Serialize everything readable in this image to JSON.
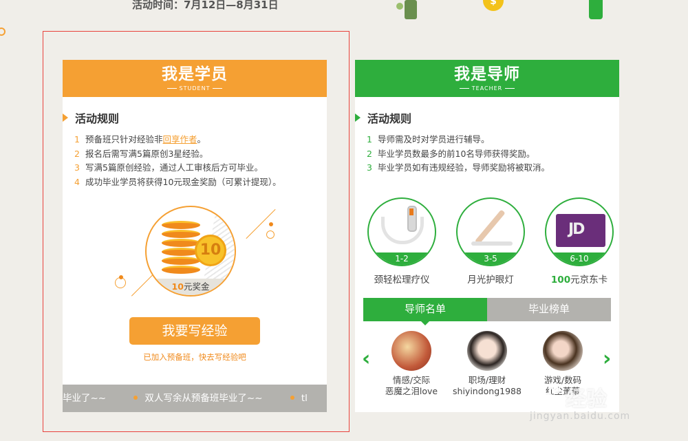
{
  "header": {
    "event_date": "活动时间：7月12日—8月31日"
  },
  "student_card": {
    "title": "我是学员",
    "subtitle": "STUDENT",
    "rules_heading": "活动规则",
    "rules": [
      {
        "num": "1",
        "text": "预备班只针对经验非",
        "link": "回享作者",
        "after": "。"
      },
      {
        "num": "2",
        "text": "报名后需写满5篇原创3星经验。"
      },
      {
        "num": "3",
        "text": "写满5篇原创经验，通过人工审核后方可毕业。"
      },
      {
        "num": "4",
        "text": "成功毕业学员将获得10元现金奖励（可累计提现）。"
      }
    ],
    "coin_value": "10",
    "reward_amount": "10",
    "reward_unit": "元奖金",
    "write_button": "我要写经验",
    "joined_note": "已加入预备班，快去写经验吧",
    "ticker_left": "毕业了~~",
    "ticker_main": "双人写余从预备班毕业了~~",
    "ticker_right": "tl"
  },
  "teacher_card": {
    "title": "我是导师",
    "subtitle": "TEACHER",
    "rules_heading": "活动规则",
    "rules": [
      {
        "num": "1",
        "text": "导师需及时对学员进行辅导。"
      },
      {
        "num": "2",
        "text": "毕业学员数最多的前10名导师获得奖励。"
      },
      {
        "num": "3",
        "text": "毕业学员如有违规经验，导师奖励将被取消。"
      }
    ],
    "prizes": [
      {
        "range": "1-2",
        "name": "颈轻松理疗仪",
        "icon": "massager-image"
      },
      {
        "range": "3-5",
        "name": "月光护眼灯",
        "icon": "lamp-image"
      },
      {
        "range": "6-10",
        "name_bold": "100",
        "name": "元京东卡",
        "icon": "jd-card-image"
      }
    ],
    "tabs": [
      {
        "label": "导师名单",
        "active": true
      },
      {
        "label": "毕业榜单",
        "active": false
      }
    ],
    "mentors": [
      {
        "category": "情感/交际",
        "name": "恶魔之泪love"
      },
      {
        "category": "职场/理财",
        "name": "shiyindong1988"
      },
      {
        "category": "游戏/数码",
        "name": "红尘萧萧"
      }
    ]
  },
  "watermark": {
    "text": "经验",
    "url": "jingyan.baidu.com"
  },
  "colors": {
    "orange": "#f5a033",
    "green": "#2eae3d",
    "gray": "#b3b2ae",
    "frame": "#e8413b"
  }
}
